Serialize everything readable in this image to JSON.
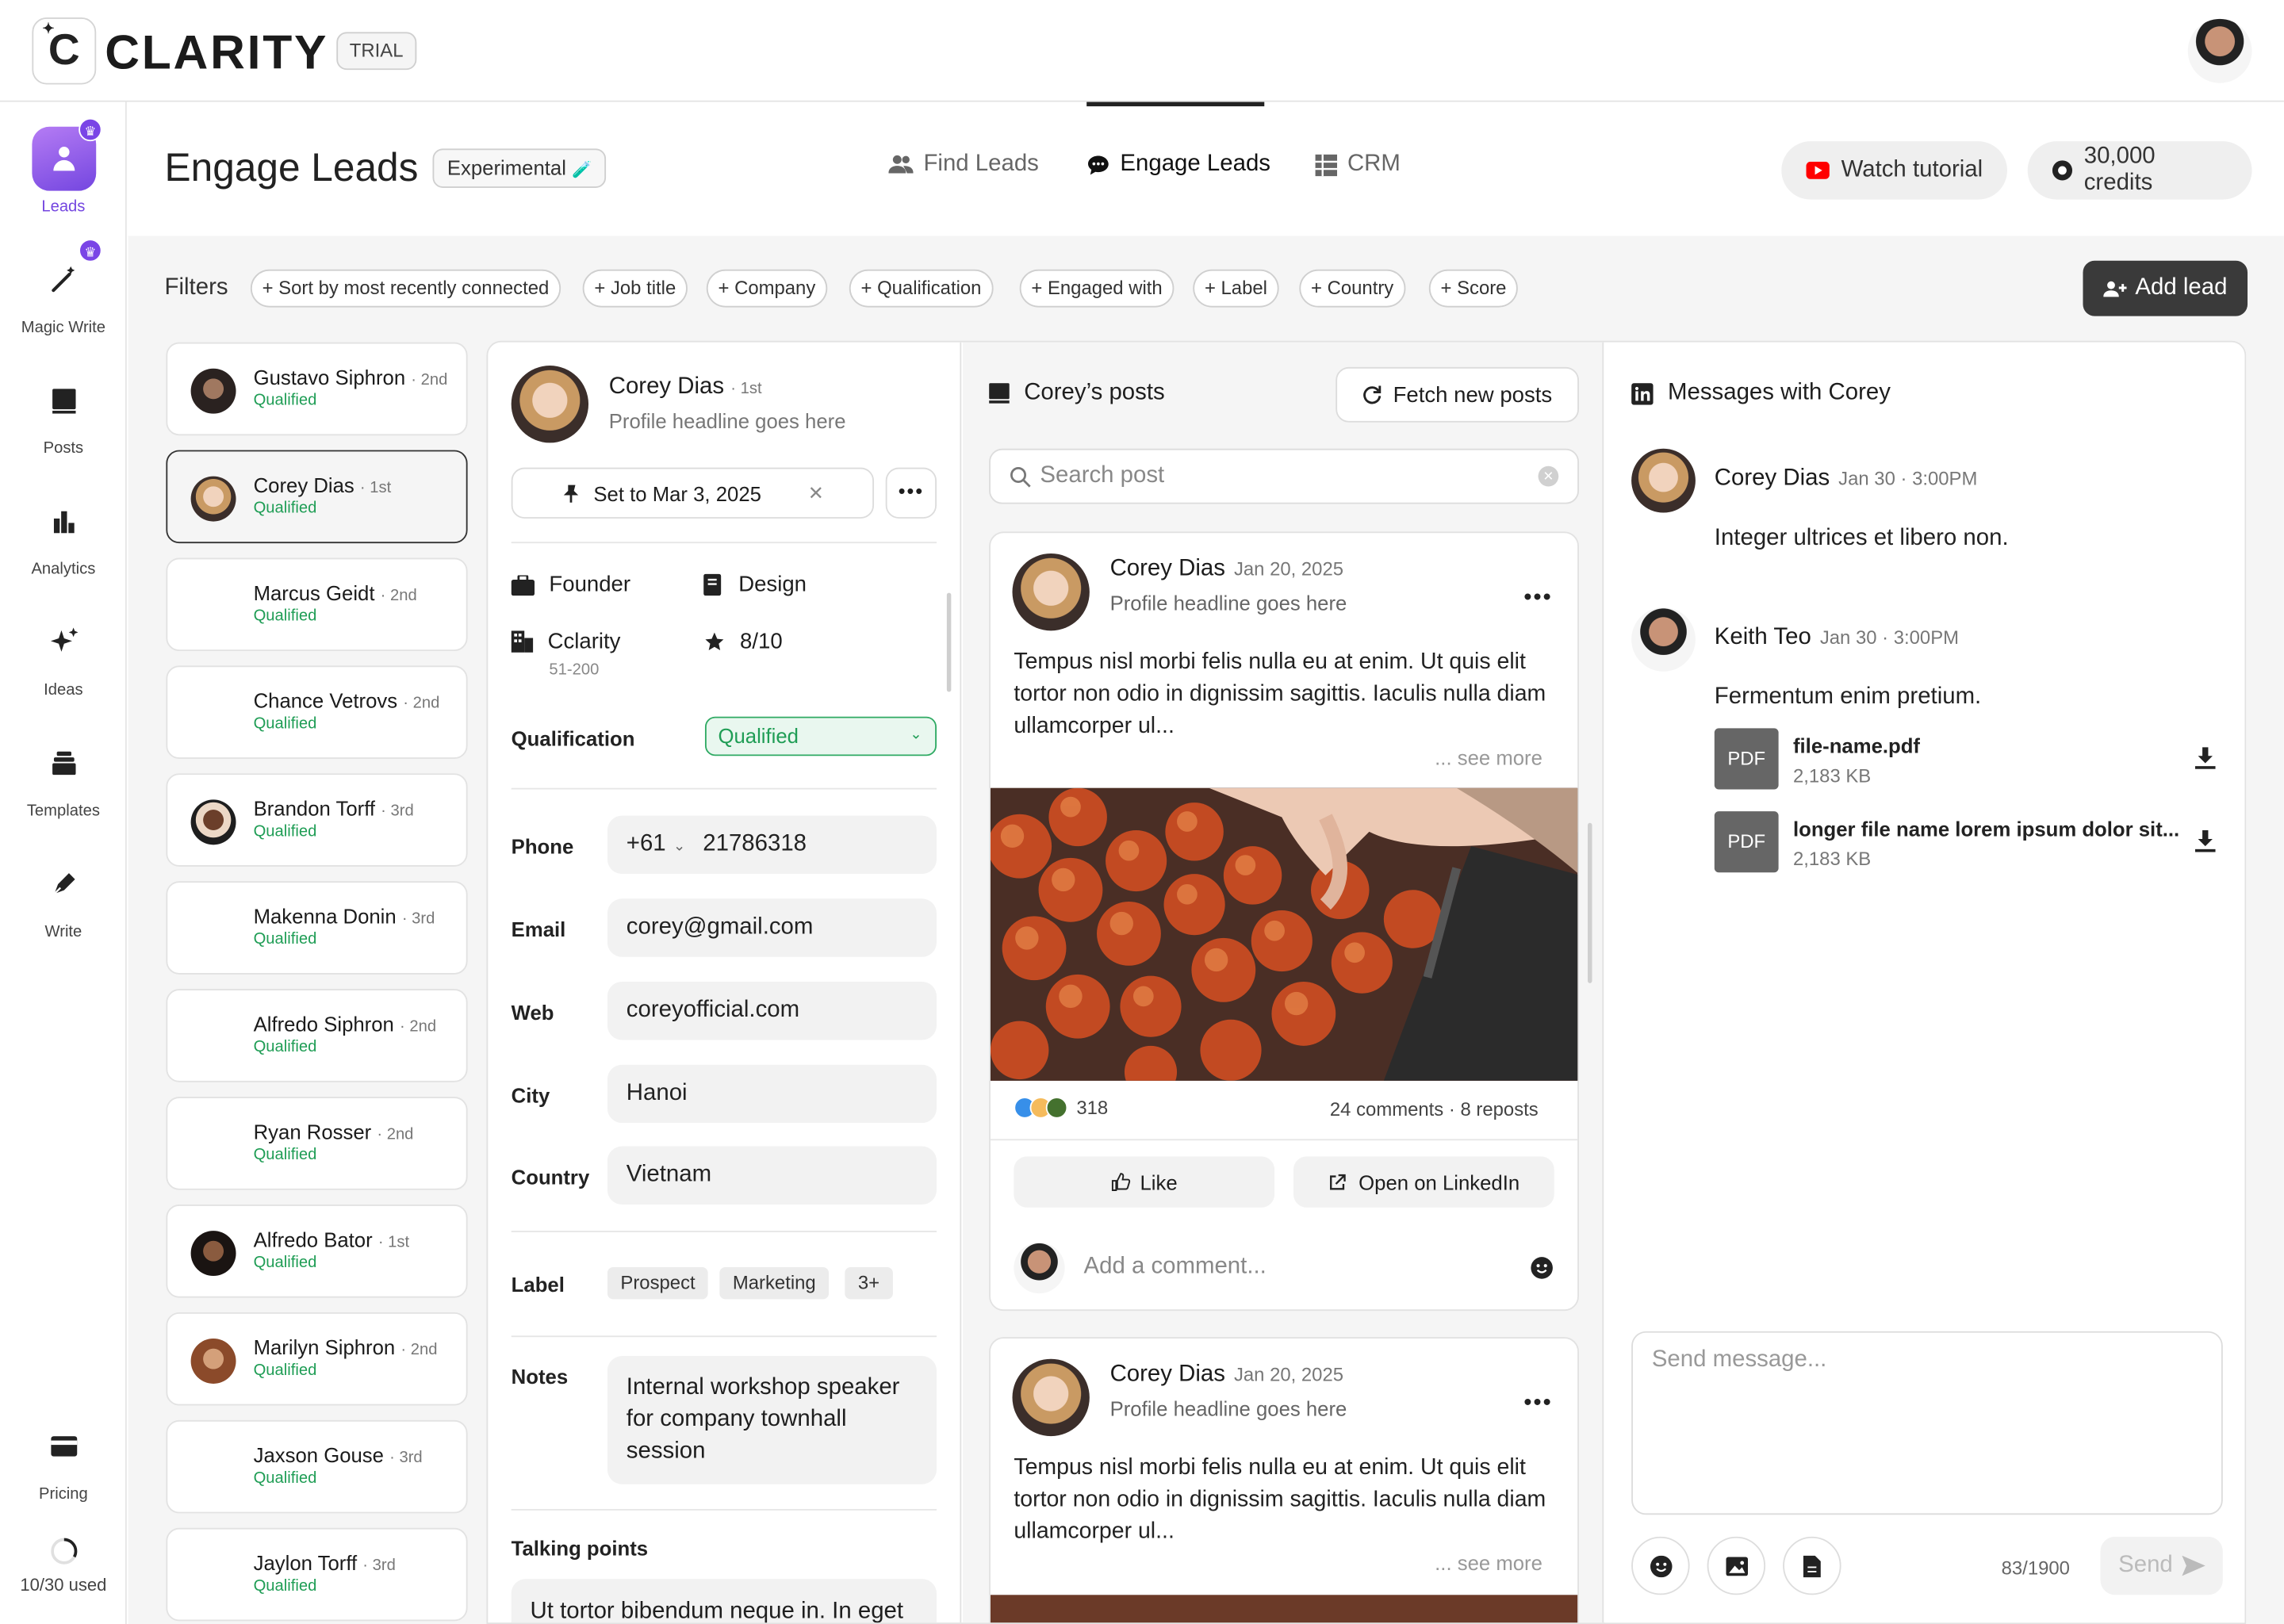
{
  "brand": {
    "logo_letter": "C",
    "name": "CLARITY",
    "badge": "TRIAL"
  },
  "rail": {
    "items": [
      {
        "label": "Leads",
        "icon": "leads-icon"
      },
      {
        "label": "Magic Write",
        "icon": "magic-wand-icon"
      },
      {
        "label": "Posts",
        "icon": "posts-icon"
      },
      {
        "label": "Analytics",
        "icon": "bar-chart-icon"
      },
      {
        "label": "Ideas",
        "icon": "sparkle-icon"
      },
      {
        "label": "Templates",
        "icon": "templates-icon"
      },
      {
        "label": "Write",
        "icon": "pen-icon"
      }
    ],
    "pricing": "Pricing",
    "usage": "10/30 used",
    "usage_fraction": 0.33
  },
  "header": {
    "title": "Engage Leads",
    "experimental": "Experimental",
    "tabs": [
      "Find Leads",
      "Engage Leads",
      "CRM"
    ],
    "active_tab": "Engage Leads",
    "watch_tutorial": "Watch tutorial",
    "credits": "30,000 credits"
  },
  "filters": {
    "label": "Filters",
    "chips": [
      "+ Sort by most recently connected",
      "+ Job title",
      "+ Company",
      "+ Qualification",
      "+ Engaged with",
      "+ Label",
      "+ Country",
      "+ Score"
    ],
    "add_lead": "Add lead"
  },
  "leads": [
    {
      "name": "Gustavo Siphron",
      "degree": "· 2nd",
      "status": "Qualified"
    },
    {
      "name": "Corey Dias",
      "degree": "· 1st",
      "status": "Qualified"
    },
    {
      "name": "Marcus Geidt",
      "degree": "· 2nd",
      "status": "Qualified"
    },
    {
      "name": "Chance Vetrovs",
      "degree": "· 2nd",
      "status": "Qualified"
    },
    {
      "name": "Brandon Torff",
      "degree": "· 3rd",
      "status": "Qualified"
    },
    {
      "name": "Makenna Donin",
      "degree": "· 3rd",
      "status": "Qualified"
    },
    {
      "name": "Alfredo Siphron",
      "degree": "· 2nd",
      "status": "Qualified"
    },
    {
      "name": "Ryan Rosser",
      "degree": "· 2nd",
      "status": "Qualified"
    },
    {
      "name": "Alfredo Bator",
      "degree": "· 1st",
      "status": "Qualified"
    },
    {
      "name": "Marilyn Siphron",
      "degree": "· 2nd",
      "status": "Qualified"
    },
    {
      "name": "Jaxson Gouse",
      "degree": "· 3rd",
      "status": "Qualified"
    },
    {
      "name": "Jaylon Torff",
      "degree": "· 3rd",
      "status": "Qualified"
    }
  ],
  "profile": {
    "name": "Corey Dias",
    "degree": "· 1st",
    "headline": "Profile headline goes here",
    "reminder": "Set to Mar 3, 2025",
    "role": "Founder",
    "department": "Design",
    "company": "Cclarity",
    "company_size": "51-200",
    "score": "8/10",
    "qualification_label": "Qualification",
    "qualification": "Qualified",
    "phone_label": "Phone",
    "phone_code": "+61",
    "phone": "21786318",
    "email_label": "Email",
    "email": "corey@gmail.com",
    "web_label": "Web",
    "web": "coreyofficial.com",
    "city_label": "City",
    "city": "Hanoi",
    "country_label": "Country",
    "country": "Vietnam",
    "label_label": "Label",
    "labels": [
      "Prospect",
      "Marketing",
      "3+"
    ],
    "notes_label": "Notes",
    "notes": "Internal workshop speaker for company townhall session",
    "talking_points_label": "Talking points",
    "talking_points": "Ut tortor bibendum neque in. In eget"
  },
  "posts": {
    "title": "Corey’s posts",
    "fetch": "Fetch new posts",
    "search_placeholder": "Search post",
    "items": [
      {
        "author": "Corey Dias",
        "date": "Jan 20, 2025",
        "headline": "Profile headline goes here",
        "text": "Tempus nisl morbi felis nulla eu at enim. Ut quis elit tortor non odio in dignissim sagittis. Iaculis nulla diam ullamcorper ul...",
        "see_more": "... see more",
        "reactions": "318",
        "comments": "24 comments",
        "reposts": "8 reposts",
        "like": "Like",
        "open": "Open on LinkedIn",
        "comment_placeholder": "Add a comment..."
      },
      {
        "author": "Corey Dias",
        "date": "Jan 20, 2025",
        "headline": "Profile headline goes here",
        "text": "Tempus nisl morbi felis nulla eu at enim. Ut quis elit tortor non odio in dignissim sagittis. Iaculis nulla diam ullamcorper ul...",
        "see_more": "... see more"
      }
    ]
  },
  "messages": {
    "title": "Messages with Corey",
    "items": [
      {
        "name": "Corey Dias",
        "time": "Jan 30 · 3:00PM",
        "text": "Integer ultrices et libero non."
      },
      {
        "name": "Keith Teo",
        "time": "Jan 30 · 3:00PM",
        "text": "Fermentum enim pretium."
      }
    ],
    "files": [
      {
        "type": "PDF",
        "name": "file-name.pdf",
        "size": "2,183 KB"
      },
      {
        "type": "PDF",
        "name": "longer file name lorem ipsum dolor sit...",
        "size": "2,183 KB"
      }
    ],
    "placeholder": "Send message...",
    "counter": "83/1900",
    "send": "Send"
  },
  "colors": {
    "accent": "#7446e0",
    "qualified": "#1f9d55",
    "dark_button": "#3a3a3a",
    "youtube": "#ff0000"
  }
}
